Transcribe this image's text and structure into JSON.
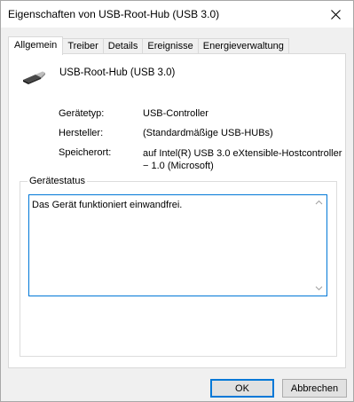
{
  "window": {
    "title": "Eigenschaften von USB-Root-Hub (USB 3.0)"
  },
  "tabs": [
    {
      "label": "Allgemein",
      "active": true
    },
    {
      "label": "Treiber",
      "active": false
    },
    {
      "label": "Details",
      "active": false
    },
    {
      "label": "Ereignisse",
      "active": false
    },
    {
      "label": "Energieverwaltung",
      "active": false
    }
  ],
  "device": {
    "name": "USB-Root-Hub (USB 3.0)",
    "icon": "usb-plug-icon"
  },
  "properties": [
    {
      "label": "Gerätetyp:",
      "value": "USB-Controller"
    },
    {
      "label": "Hersteller:",
      "value": "(Standardmäßige USB-HUBs)"
    },
    {
      "label": "Speicherort:",
      "value": "auf Intel(R) USB 3.0 eXtensible-Hostcontroller − 1.0 (Microsoft)"
    }
  ],
  "status": {
    "group_label": "Gerätestatus",
    "text": "Das Gerät funktioniert einwandfrei."
  },
  "buttons": {
    "ok": "OK",
    "cancel": "Abbrechen"
  },
  "colors": {
    "accent": "#0078d7",
    "titlebar": "#ffffff",
    "dialog_bg": "#f0f0f0"
  }
}
